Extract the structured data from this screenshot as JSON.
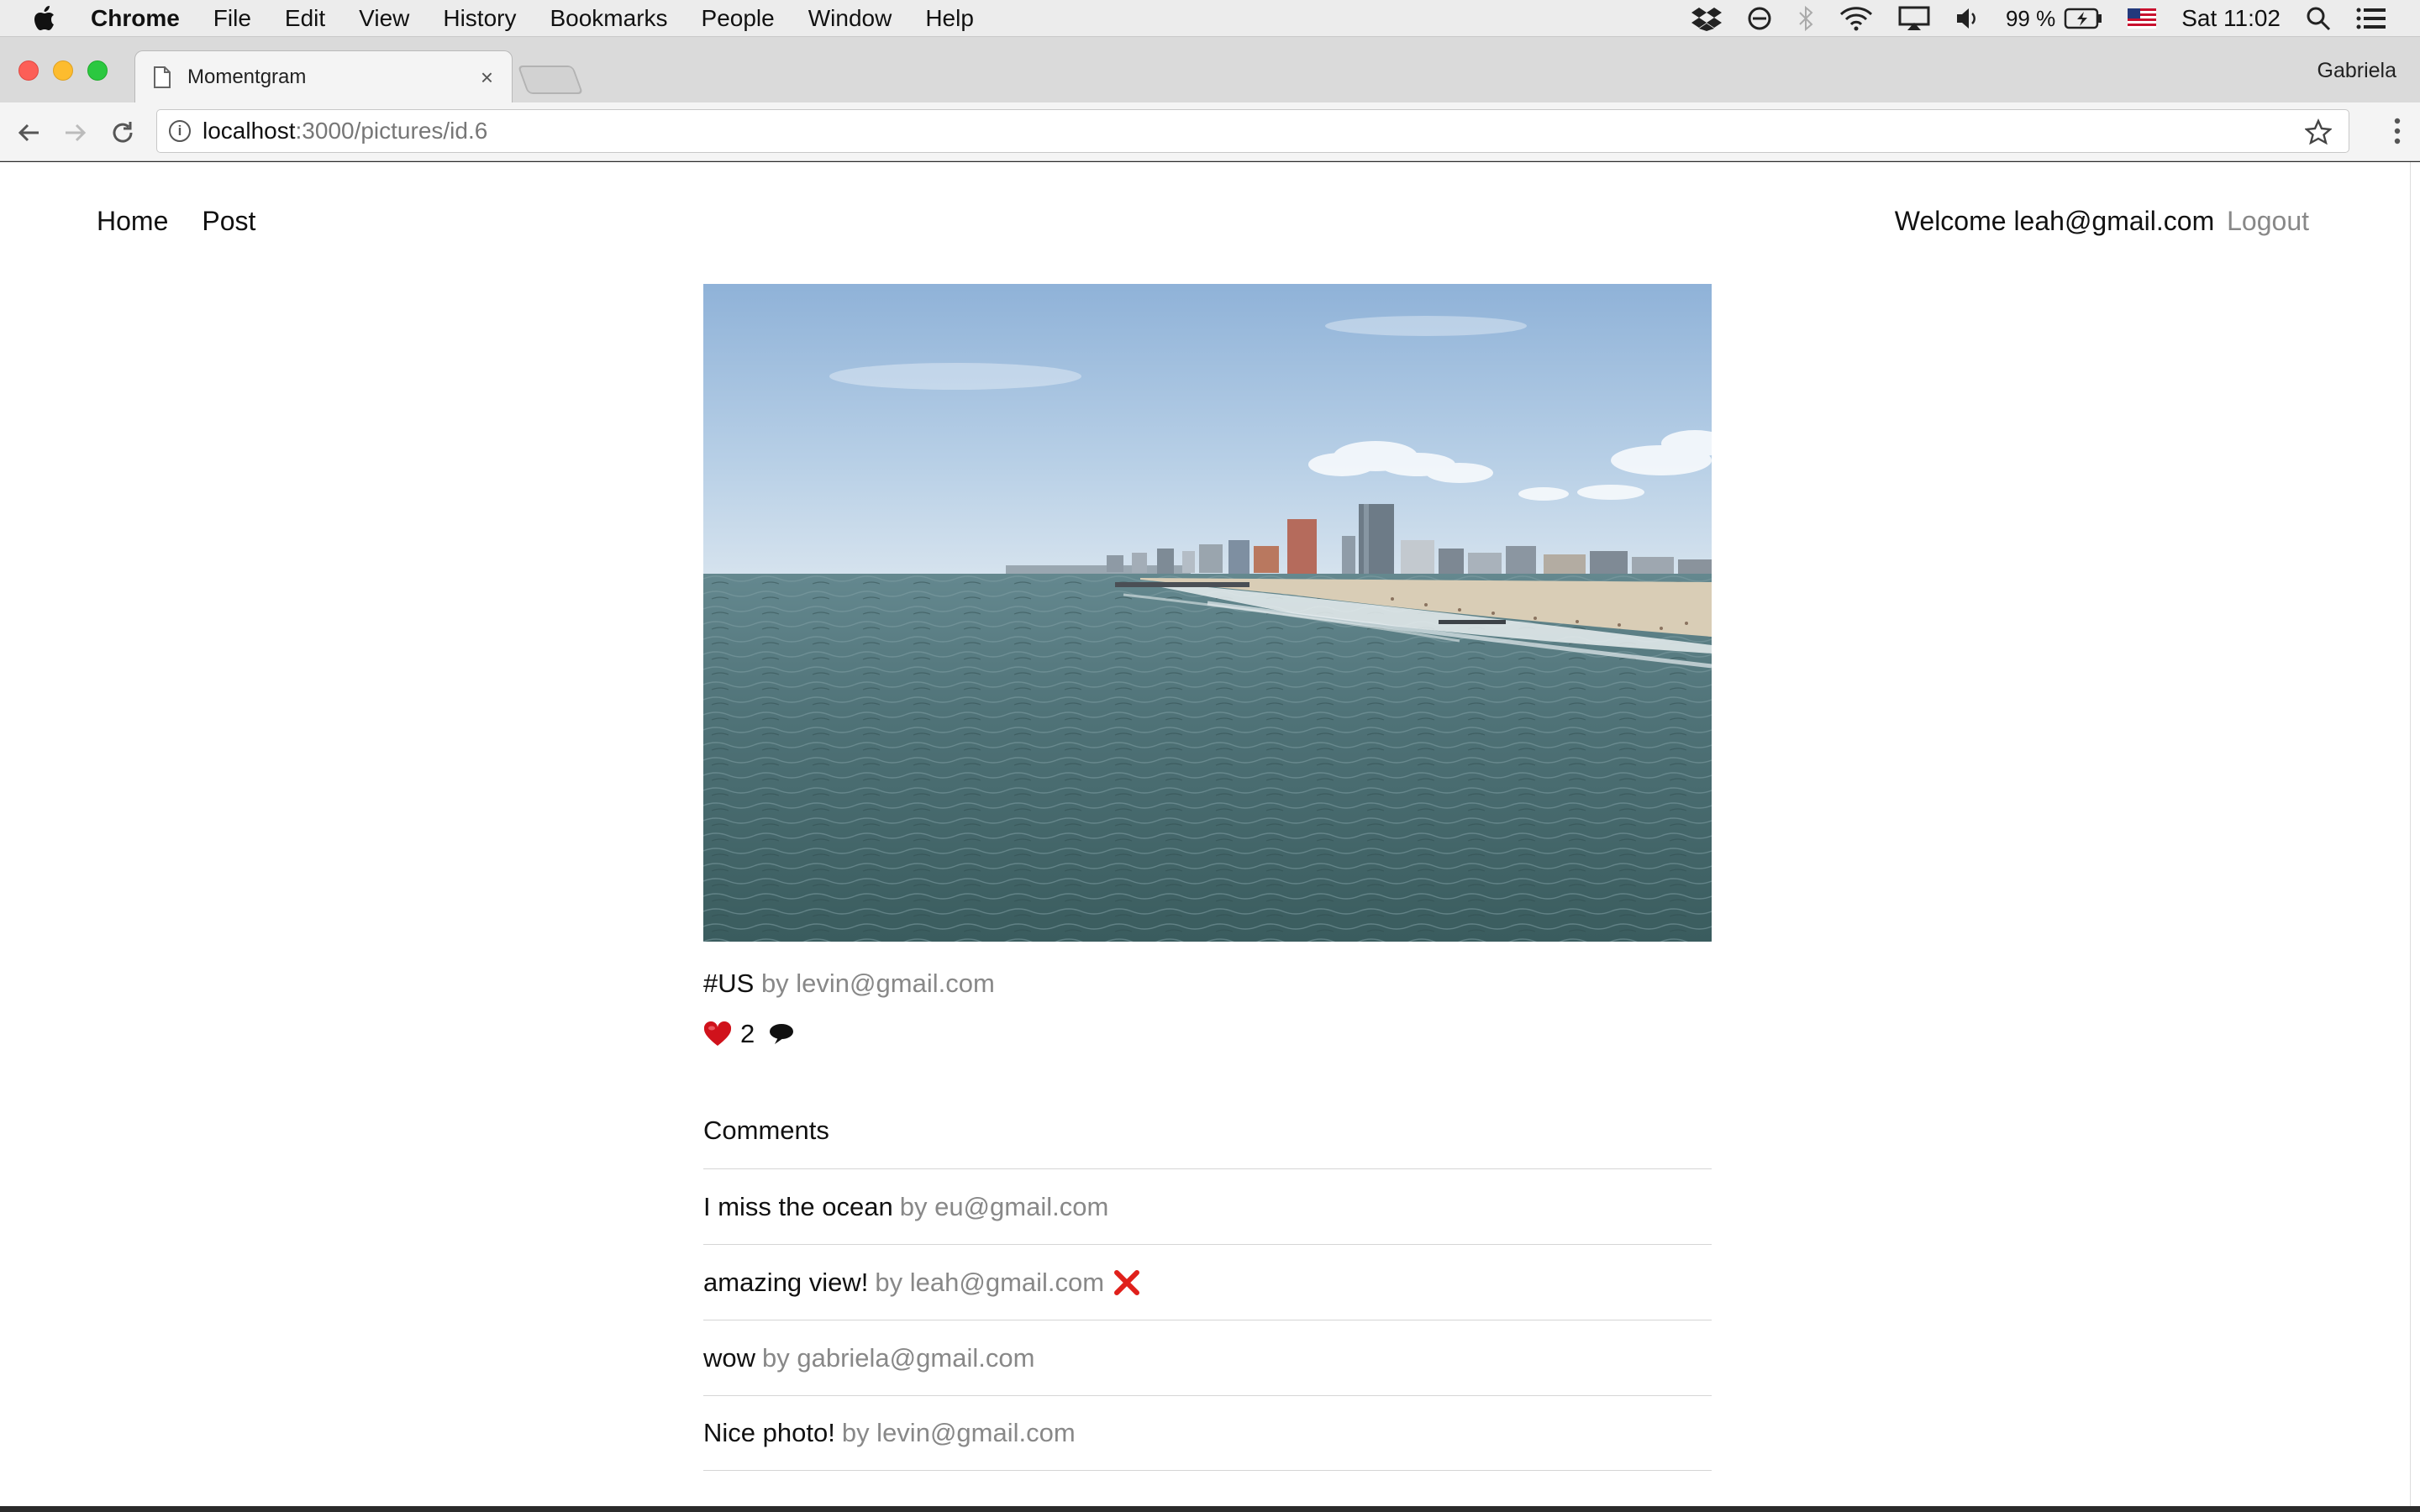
{
  "menubar": {
    "app": "Chrome",
    "items": [
      "File",
      "Edit",
      "View",
      "History",
      "Bookmarks",
      "People",
      "Window",
      "Help"
    ],
    "battery": "99 %",
    "clock": "Sat 11:02",
    "icons": [
      "dropbox-icon",
      "sync-icon",
      "bluetooth-icon",
      "wifi-icon",
      "airplay-icon",
      "volume-icon",
      "battery-icon",
      "flag-icon",
      "spotlight-icon",
      "notification-center-icon"
    ]
  },
  "browser": {
    "tab_title": "Momentgram",
    "profile": "Gabriela",
    "url_host": "localhost",
    "url_path": ":3000/pictures/id.6"
  },
  "nav": {
    "home": "Home",
    "post": "Post",
    "welcome": "Welcome leah@gmail.com",
    "logout": "Logout"
  },
  "picture": {
    "tag": "#US",
    "by": "by levin@gmail.com",
    "likes": "2",
    "like_icon": "heart-icon",
    "comment_icon": "speech-bubble-icon"
  },
  "comments": {
    "title": "Comments",
    "items": [
      {
        "text": "I miss the ocean",
        "by": "by eu@gmail.com",
        "deletable": false
      },
      {
        "text": "amazing view!",
        "by": "by leah@gmail.com",
        "deletable": true
      },
      {
        "text": "wow",
        "by": "by gabriela@gmail.com",
        "deletable": false
      },
      {
        "text": "Nice photo!",
        "by": "by levin@gmail.com",
        "deletable": false
      }
    ]
  },
  "colors": {
    "muted_text": "#888888",
    "delete": "#e0201b",
    "heart": "#d0121b"
  }
}
